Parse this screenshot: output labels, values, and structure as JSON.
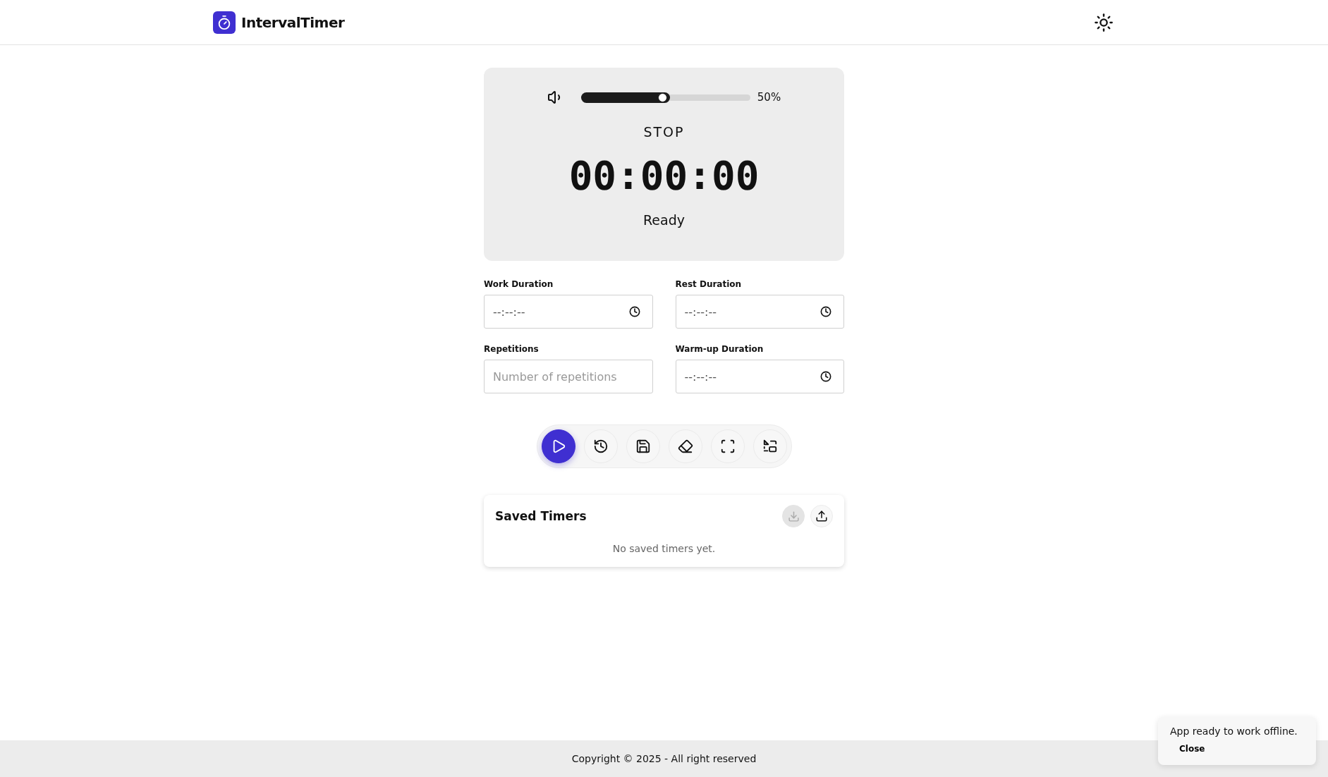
{
  "header": {
    "app_name": "IntervalTimer"
  },
  "timer_card": {
    "volume": {
      "level": 0.5,
      "reading": "50%"
    },
    "phase": "STOP",
    "time": "00:00:00",
    "status": "Ready"
  },
  "fields": [
    {
      "label": "Work Duration",
      "kind": "time",
      "placeholder": "--:--:--"
    },
    {
      "label": "Rest Duration",
      "kind": "time",
      "placeholder": "--:--:--"
    },
    {
      "label": "Repetitions",
      "kind": "number",
      "placeholder": "Number of repetitions"
    },
    {
      "label": "Warm-up Duration",
      "kind": "time",
      "placeholder": "--:--:--"
    }
  ],
  "controls": [
    {
      "kind": "play",
      "primary": true
    },
    {
      "kind": "history",
      "primary": false
    },
    {
      "kind": "save",
      "primary": false
    },
    {
      "kind": "clear",
      "primary": false
    },
    {
      "kind": "fullscreen",
      "primary": false
    },
    {
      "kind": "pip",
      "primary": false
    }
  ],
  "saved_timers": {
    "title": "Saved Timers",
    "empty_text": "No saved timers yet.",
    "actions": [
      {
        "kind": "import",
        "disabled": true
      },
      {
        "kind": "export",
        "disabled": false
      }
    ]
  },
  "footer": {
    "text": "Copyright © 2025 - All right reserved"
  },
  "toast": {
    "message": "App ready to work offline.",
    "action": "Close"
  }
}
